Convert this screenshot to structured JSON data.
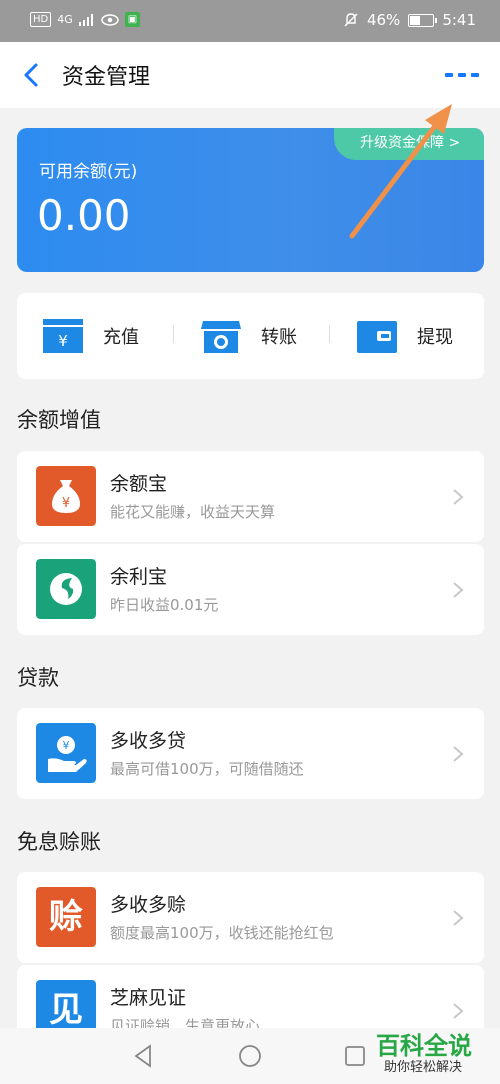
{
  "status_bar": {
    "left_chips": [
      "HD",
      "4G"
    ],
    "battery": "46%",
    "battery_level": 0.46,
    "time": "5:41"
  },
  "header": {
    "title": "资金管理",
    "back_icon": "chevron-left-icon",
    "more_icon": "more-dots-icon"
  },
  "balance_card": {
    "label": "可用余额(元)",
    "value": "0.00",
    "upgrade_label": "升级资金保障 >"
  },
  "actions": [
    {
      "label": "充值",
      "icon": "recharge-icon"
    },
    {
      "label": "转账",
      "icon": "transfer-icon"
    },
    {
      "label": "提现",
      "icon": "withdraw-icon"
    }
  ],
  "sections": {
    "balance_growth": "余额增值",
    "loan": "贷款",
    "interest_free": "免息赊账"
  },
  "items": {
    "yuebao": {
      "name": "余额宝",
      "desc": "能花又能赚，收益天天算",
      "icon": "money-bag-icon",
      "color": "#e35a2a"
    },
    "yulibao": {
      "name": "余利宝",
      "desc": "昨日收益0.01元",
      "icon": "yulibao-icon",
      "color": "#1aa37a"
    },
    "duoshou_daikuan": {
      "name": "多收多贷",
      "desc": "最高可借100万，可随借随还",
      "icon": "loan-hand-icon",
      "color": "#1e88e5"
    },
    "duoshou_shezhang": {
      "name": "多收多赊",
      "desc": "额度最高100万，收钱还能抢红包",
      "icon": "she-char-icon",
      "color": "#e35a2a",
      "glyph": "赊"
    },
    "zhima": {
      "name": "芝麻见证",
      "desc": "见证赊销，生意更放心",
      "icon": "jian-char-icon",
      "color": "#1e88e5",
      "glyph": "见"
    }
  },
  "watermark": {
    "big": "百科全说",
    "small": "助你轻松解决"
  },
  "colors": {
    "accent": "#1677ff",
    "card": "#3a8bea",
    "annotation_arrow": "#f0914a"
  }
}
